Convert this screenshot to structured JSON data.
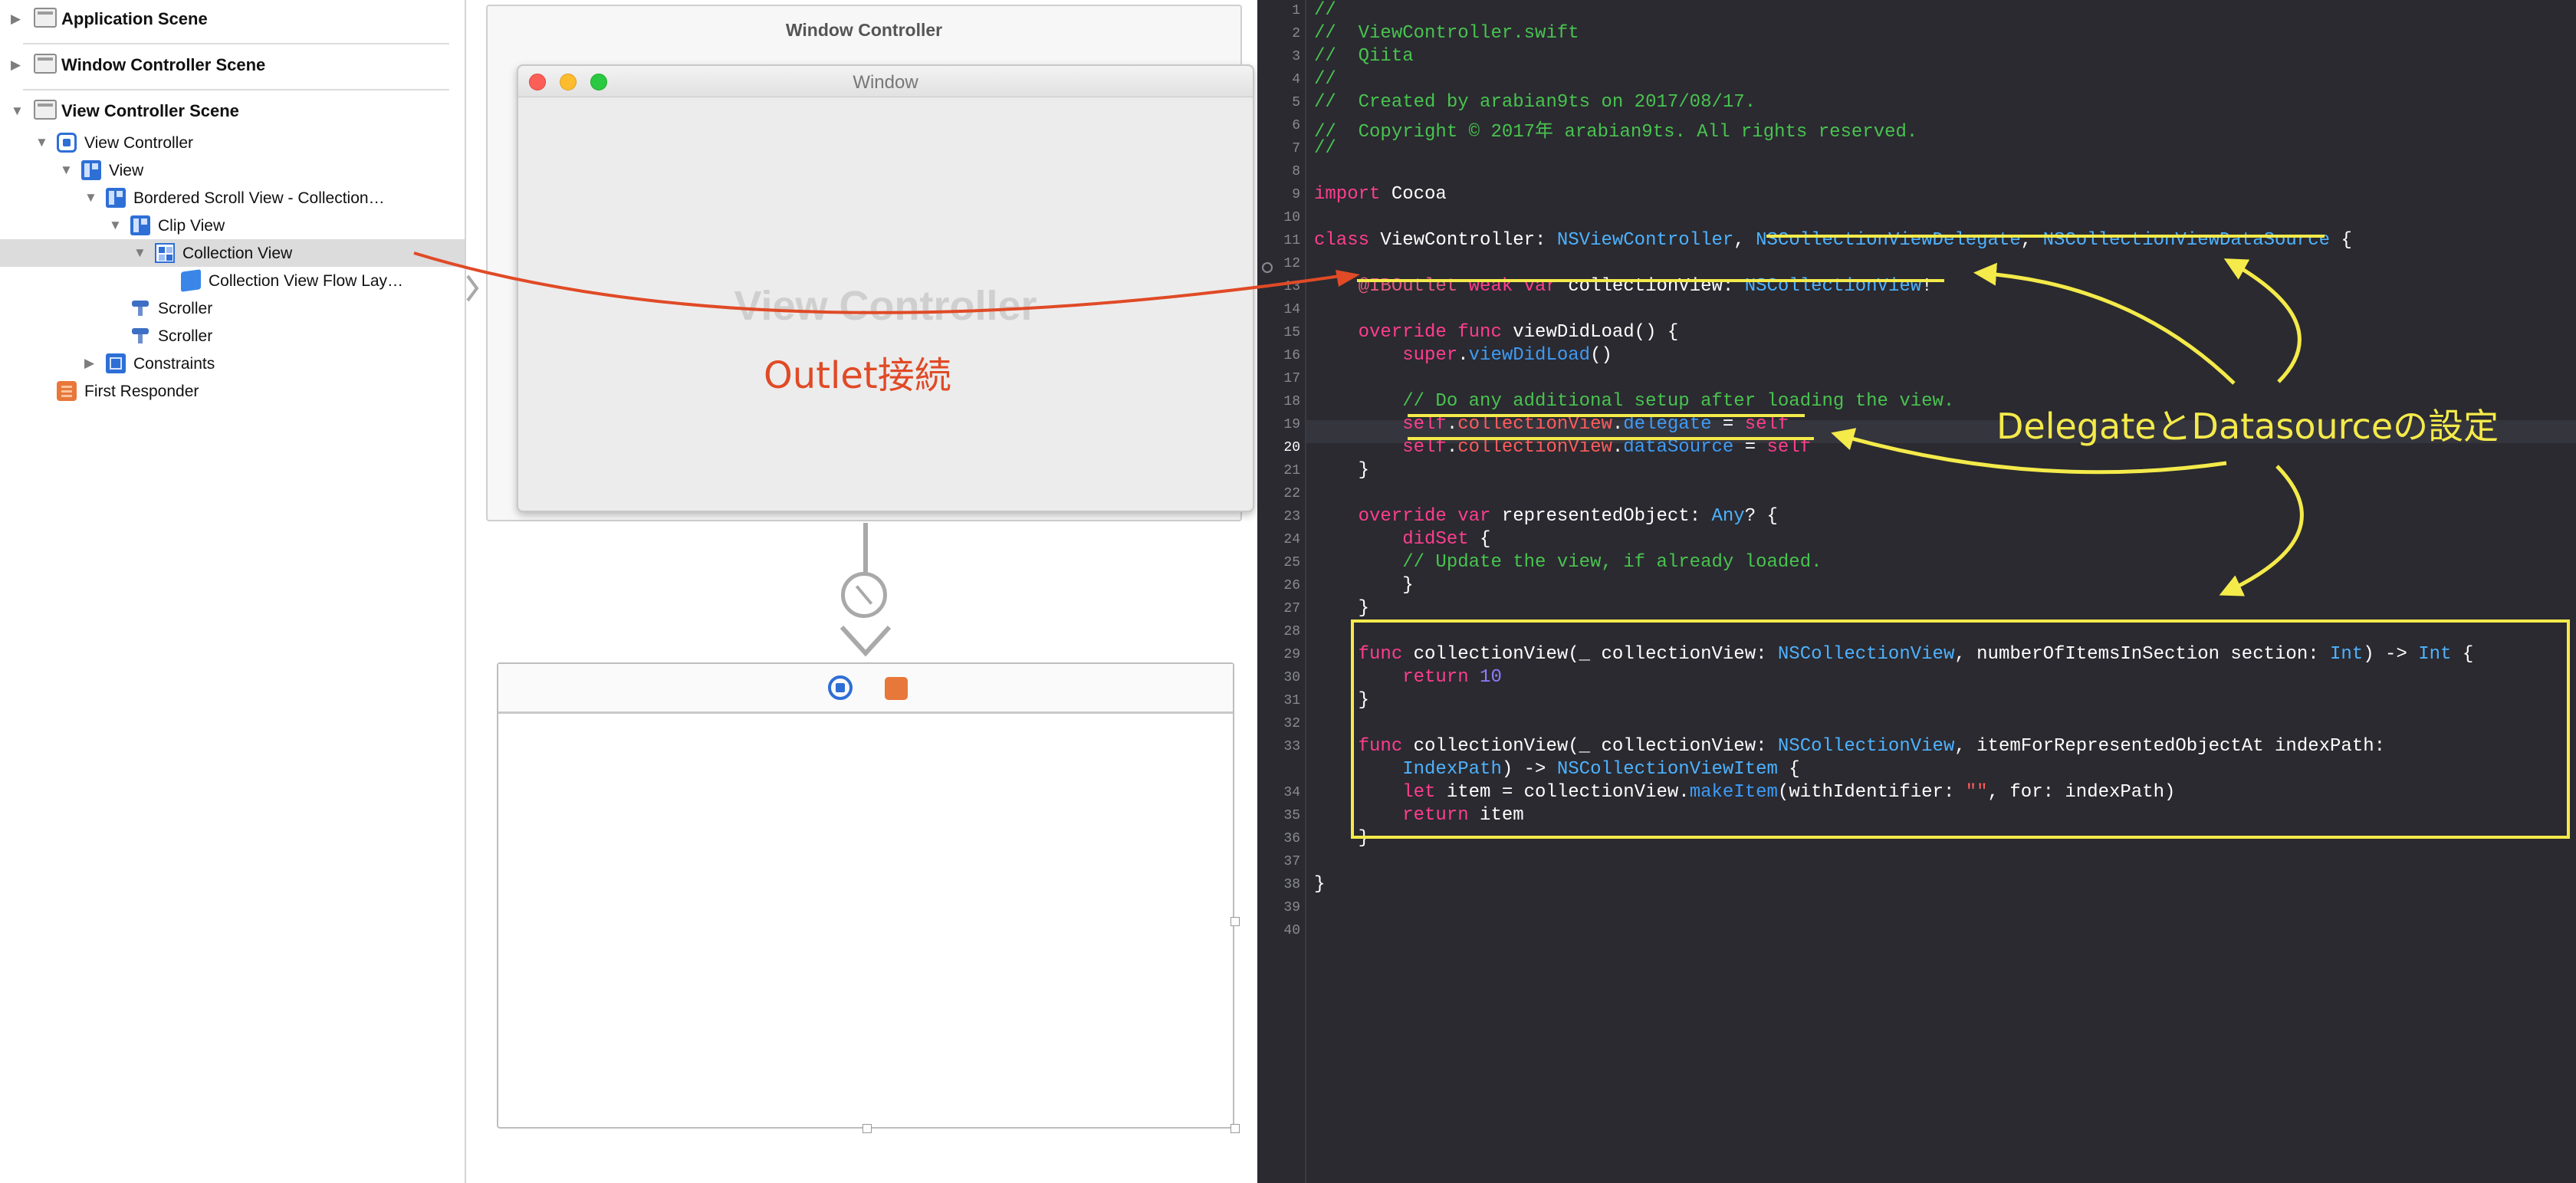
{
  "outline": {
    "scenes": [
      {
        "label": "Application Scene"
      },
      {
        "label": "Window Controller Scene"
      },
      {
        "label": "View Controller Scene"
      }
    ],
    "tree": [
      {
        "label": "View Controller",
        "icon": "view-controller-icon"
      },
      {
        "label": "View",
        "icon": "view-icon"
      },
      {
        "label": "Bordered Scroll View - Collection…",
        "icon": "scroll-view-icon"
      },
      {
        "label": "Clip View",
        "icon": "clip-view-icon"
      },
      {
        "label": "Collection View",
        "icon": "collection-view-icon",
        "selected": true
      },
      {
        "label": "Collection View Flow Lay…",
        "icon": "flow-layout-cube-icon"
      },
      {
        "label": "Scroller",
        "icon": "scroller-icon"
      },
      {
        "label": "Scroller",
        "icon": "scroller-icon"
      },
      {
        "label": "Constraints",
        "icon": "constraints-icon"
      },
      {
        "label": "First Responder",
        "icon": "first-responder-icon"
      }
    ]
  },
  "canvas": {
    "window_controller_title": "Window Controller",
    "window_title": "Window",
    "view_controller_watermark": "View Controller"
  },
  "editor": {
    "current_line": 20,
    "line_numbers": [
      "1",
      "2",
      "3",
      "4",
      "5",
      "6",
      "7",
      "8",
      "9",
      "10",
      "11",
      "12",
      "13",
      "14",
      "15",
      "16",
      "17",
      "18",
      "19",
      "20",
      "21",
      "22",
      "23",
      "24",
      "25",
      "26",
      "27",
      "28",
      "29",
      "30",
      "31",
      "32",
      "33",
      "",
      "34",
      "35",
      "36",
      "37",
      "38",
      "39",
      "40"
    ],
    "lines": [
      "//",
      "//  ViewController.swift",
      "//  Qiita",
      "//",
      "//  Created by arabian9ts on 2017/08/17.",
      "//  Copyright © 2017年 arabian9ts. All rights reserved.",
      "//",
      "",
      "import Cocoa",
      "",
      "class ViewController: NSViewController, NSCollectionViewDelegate, NSCollectionViewDataSource {",
      "",
      "    @IBOutlet weak var collectionView: NSCollectionView!",
      "",
      "    override func viewDidLoad() {",
      "        super.viewDidLoad()",
      "",
      "        // Do any additional setup after loading the view.",
      "        self.collectionView.delegate = self",
      "        self.collectionView.dataSource = self",
      "    }",
      "",
      "    override var representedObject: Any? {",
      "        didSet {",
      "        // Update the view, if already loaded.",
      "        }",
      "    }",
      "",
      "    func collectionView(_ collectionView: NSCollectionView, numberOfItemsInSection section: Int) -> Int {",
      "        return 10",
      "    }",
      "",
      "    func collectionView(_ collectionView: NSCollectionView, itemForRepresentedObjectAt indexPath:",
      "        IndexPath) -> NSCollectionViewItem {",
      "        let item = collectionView.makeItem(withIdentifier: \"\", for: indexPath)",
      "        return item",
      "    }",
      "",
      "}",
      "",
      ""
    ]
  },
  "annotations": {
    "outlet": "Outlet接続",
    "delegate": "DelegateとDatasourceの設定",
    "outlet_color": "#e04a26",
    "highlight_color": "#f4ea4a"
  }
}
